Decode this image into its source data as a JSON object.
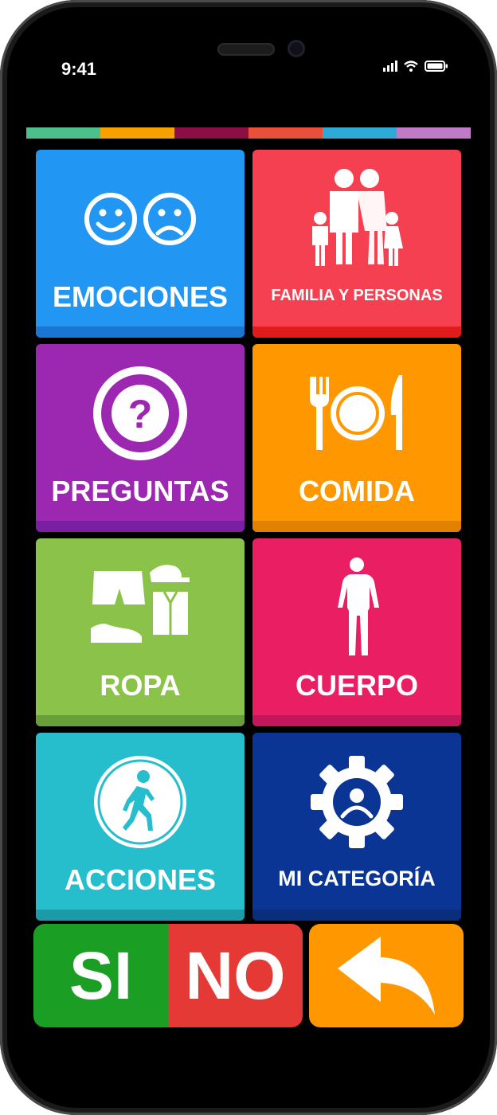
{
  "status_bar": {
    "time": "9:41"
  },
  "color_strip": [
    "#4dbf8a",
    "#f5a200",
    "#8b0f44",
    "#e8503a",
    "#2fa9d6",
    "#c07bc7"
  ],
  "tiles": [
    {
      "label": "EMOCIONES",
      "icon": "smiley-faces-icon",
      "color": "#2196f3",
      "shade": "#1976d2"
    },
    {
      "label": "FAMILIA Y PERSONAS",
      "icon": "family-icon",
      "color": "#f44050",
      "shade": "#e01b1b"
    },
    {
      "label": "PREGUNTAS",
      "icon": "question-icon",
      "color": "#9c27b0",
      "shade": "#7b1fa2"
    },
    {
      "label": "COMIDA",
      "icon": "plate-cutlery-icon",
      "color": "#ff9800",
      "shade": "#e08200"
    },
    {
      "label": "ROPA",
      "icon": "clothes-icon",
      "color": "#8bc34a",
      "shade": "#689f38"
    },
    {
      "label": "CUERPO",
      "icon": "human-body-icon",
      "color": "#e91e63",
      "shade": "#c2185b"
    },
    {
      "label": "ACCIONES",
      "icon": "walking-person-icon",
      "color": "#26bdcc",
      "shade": "#1c9aa8"
    },
    {
      "label": "MI CATEGORÍA",
      "icon": "gear-user-icon",
      "color": "#0a3595",
      "shade": "#0a2d7e"
    }
  ],
  "bottom": {
    "yes_label": "SI",
    "no_label": "NO",
    "yes_color": "#1a9e24",
    "no_color": "#e53935",
    "back_color": "#ff9800",
    "back_icon": "back-arrow-icon"
  }
}
